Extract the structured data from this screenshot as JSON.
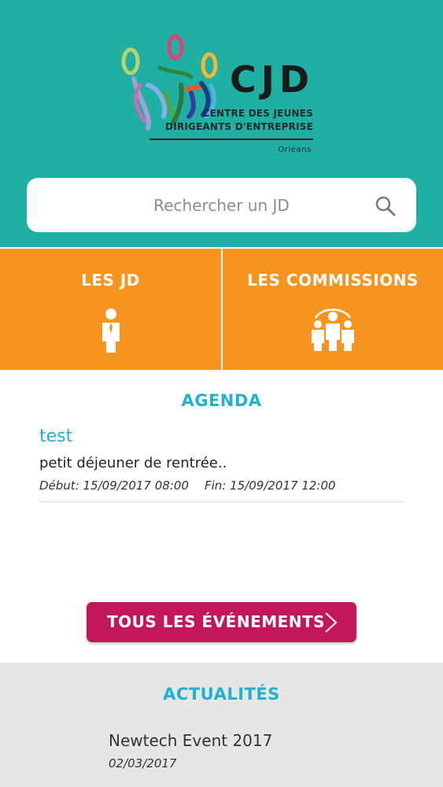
{
  "header": {
    "logo_text": "CJD",
    "logo_subtitle_line1": "CENTRE DES JEUNES",
    "logo_subtitle_line2": "DIRIGEANTS D'ENTREPRISE",
    "logo_city": "Orléans",
    "background_color": "#1fb0a3"
  },
  "search": {
    "placeholder": "Rechercher un JD",
    "icon": "search-icon"
  },
  "tiles": [
    {
      "label": "LES JD",
      "icon": "person-icon"
    },
    {
      "label": "LES COMMISSIONS",
      "icon": "group-icon"
    }
  ],
  "tiles_color": "#f7931e",
  "agenda": {
    "title": "AGENDA",
    "events": [
      {
        "title": "test",
        "description": "petit déjeuner de rentrée..",
        "start": "Début: 15/09/2017 08:00",
        "end": "Fin: 15/09/2017 12:00"
      }
    ],
    "all_events_label": "TOUS LES ÉVÉNEMENTS",
    "accent_color": "#22b0cf",
    "button_color": "#c2185b"
  },
  "news": {
    "title": "ACTUALITÉS",
    "items": [
      {
        "title": "Newtech Event 2017",
        "date": "02/03/2017"
      }
    ]
  }
}
